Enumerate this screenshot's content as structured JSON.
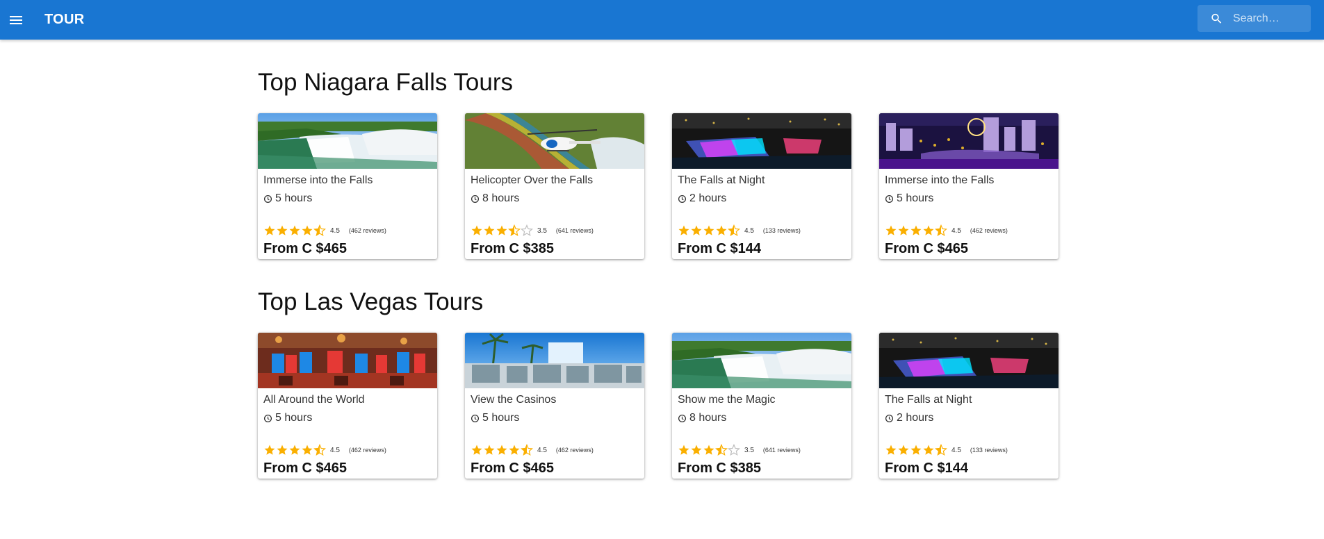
{
  "header": {
    "brand": "TOUR",
    "search_placeholder": "Search…"
  },
  "sections": [
    {
      "title": "Top Niagara Falls Tours",
      "cards": [
        {
          "title": "Immerse into the Falls",
          "duration": "5 hours",
          "rating": 4.5,
          "rating_text": "4.5",
          "reviews": "(462 reviews)",
          "price": "From C $465",
          "image": "niagara-falls-day"
        },
        {
          "title": "Helicopter Over the Falls",
          "duration": "8 hours",
          "rating": 3.5,
          "rating_text": "3.5",
          "reviews": "(641 reviews)",
          "price": "From C $385",
          "image": "helicopter-rainbow"
        },
        {
          "title": "The Falls at Night",
          "duration": "2 hours",
          "rating": 4.5,
          "rating_text": "4.5",
          "reviews": "(133 reviews)",
          "price": "From C $144",
          "image": "falls-night-lights"
        },
        {
          "title": "Immerse into the Falls",
          "duration": "5 hours",
          "rating": 4.5,
          "rating_text": "4.5",
          "reviews": "(462 reviews)",
          "price": "From C $465",
          "image": "las-vegas-strip-night"
        }
      ]
    },
    {
      "title": "Top Las Vegas Tours",
      "cards": [
        {
          "title": "All Around the World",
          "duration": "5 hours",
          "rating": 4.5,
          "rating_text": "4.5",
          "reviews": "(462 reviews)",
          "price": "From C $465",
          "image": "casino-floor"
        },
        {
          "title": "View the Casinos",
          "duration": "5 hours",
          "rating": 4.5,
          "rating_text": "4.5",
          "reviews": "(462 reviews)",
          "price": "From C $465",
          "image": "magic-sign-palms"
        },
        {
          "title": "Show me the Magic",
          "duration": "8 hours",
          "rating": 3.5,
          "rating_text": "3.5",
          "reviews": "(641 reviews)",
          "price": "From C $385",
          "image": "niagara-falls-day"
        },
        {
          "title": "The Falls at Night",
          "duration": "2 hours",
          "rating": 4.5,
          "rating_text": "4.5",
          "reviews": "(133 reviews)",
          "price": "From C $144",
          "image": "falls-night-lights"
        }
      ]
    }
  ],
  "colors": {
    "appbar": "#1976d2",
    "star": "#faaf00",
    "star_empty": "#bdbdbd"
  }
}
